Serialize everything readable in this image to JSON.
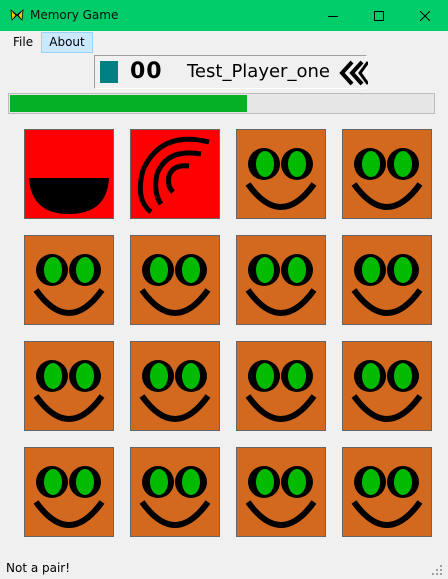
{
  "window": {
    "title": "Memory Game",
    "titlebar_color": "#00cc6a",
    "icons": {
      "app": "butterfly-icon",
      "minimize": "minimize-icon",
      "maximize": "maximize-icon",
      "close": "close-icon"
    }
  },
  "menu": {
    "file": "File",
    "about": "About"
  },
  "player": {
    "color": "#008080",
    "score": "00",
    "name": "Test_Player_one",
    "turn_icon": "double-chevron-left-icon"
  },
  "progress": {
    "value_percent": 56,
    "color": "#06b025"
  },
  "board": {
    "rows": 4,
    "cols": 4,
    "hidden_card_color": "#d2691e",
    "revealed_card_color": "#ff0000",
    "cards": [
      {
        "state": "revealed",
        "symbol": "half-circle-icon"
      },
      {
        "state": "revealed",
        "symbol": "arcs-icon"
      },
      {
        "state": "hidden",
        "symbol": "smiley-face-icon"
      },
      {
        "state": "hidden",
        "symbol": "smiley-face-icon"
      },
      {
        "state": "hidden",
        "symbol": "smiley-face-icon"
      },
      {
        "state": "hidden",
        "symbol": "smiley-face-icon"
      },
      {
        "state": "hidden",
        "symbol": "smiley-face-icon"
      },
      {
        "state": "hidden",
        "symbol": "smiley-face-icon"
      },
      {
        "state": "hidden",
        "symbol": "smiley-face-icon"
      },
      {
        "state": "hidden",
        "symbol": "smiley-face-icon"
      },
      {
        "state": "hidden",
        "symbol": "smiley-face-icon"
      },
      {
        "state": "hidden",
        "symbol": "smiley-face-icon"
      },
      {
        "state": "hidden",
        "symbol": "smiley-face-icon"
      },
      {
        "state": "hidden",
        "symbol": "smiley-face-icon"
      },
      {
        "state": "hidden",
        "symbol": "smiley-face-icon"
      },
      {
        "state": "hidden",
        "symbol": "smiley-face-icon"
      }
    ]
  },
  "status": {
    "text": "Not a pair!"
  }
}
